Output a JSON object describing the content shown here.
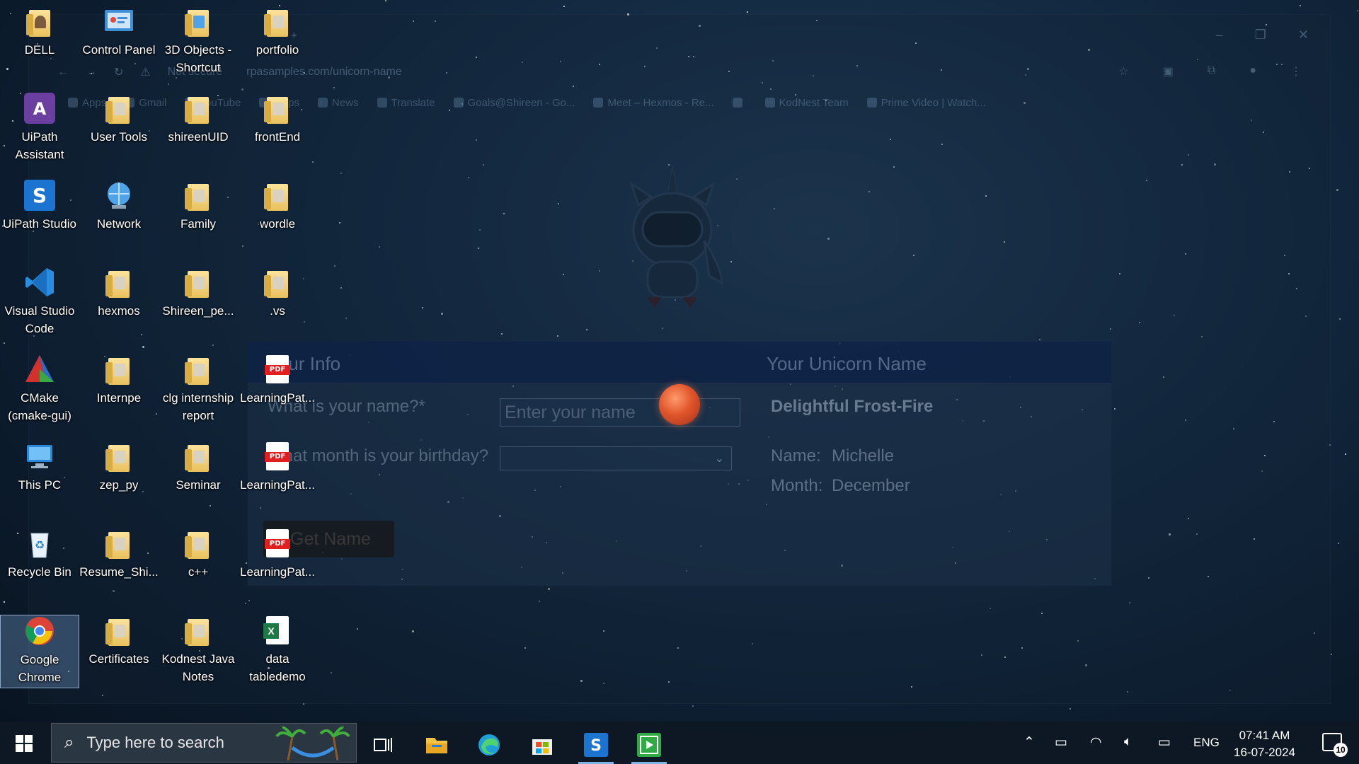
{
  "browser": {
    "tab_title": "",
    "url": "rpasamples.com/unicorn-name",
    "security_label": "Not secure",
    "bookmarks": [
      "Apps",
      "Gmail",
      "YouTube",
      "Maps",
      "News",
      "Translate",
      "Goals@Shireen - Go...",
      "Meet – Hexmos - Re...",
      "",
      "KodNest Team",
      "Prime Video | Watch..."
    ]
  },
  "form": {
    "section_info": "Your Info",
    "section_name": "Your Unicorn Name",
    "q_name": "What is your name?*",
    "name_placeholder": "Enter your name",
    "q_month": "What month is your birthday?",
    "month_value": "",
    "button": "Get Name",
    "result_title": "Delightful Frost-Fire",
    "result_name_label": "Name:",
    "result_name_value": "Michelle",
    "result_month_label": "Month:",
    "result_month_value": "December"
  },
  "desktop_icons": [
    {
      "label": "DELL"
    },
    {
      "label": "Control Panel"
    },
    {
      "label": "3D Objects - Shortcut"
    },
    {
      "label": "portfolio"
    },
    {
      "label": "UiPath Assistant"
    },
    {
      "label": "User Tools"
    },
    {
      "label": "shireenUID"
    },
    {
      "label": "frontEnd"
    },
    {
      "label": "UiPath Studio"
    },
    {
      "label": "Network"
    },
    {
      "label": "Family"
    },
    {
      "label": "wordle"
    },
    {
      "label": "Visual Studio Code"
    },
    {
      "label": "hexmos"
    },
    {
      "label": "Shireen_pe..."
    },
    {
      "label": ".vs"
    },
    {
      "label": "CMake (cmake-gui)"
    },
    {
      "label": "Internpe"
    },
    {
      "label": "clg internship report"
    },
    {
      "label": "LearningPat..."
    },
    {
      "label": "This PC"
    },
    {
      "label": "zep_py"
    },
    {
      "label": "Seminar"
    },
    {
      "label": "LearningPat..."
    },
    {
      "label": "Recycle Bin"
    },
    {
      "label": "Resume_Shi..."
    },
    {
      "label": "c++"
    },
    {
      "label": "LearningPat..."
    },
    {
      "label": "Google Chrome"
    },
    {
      "label": "Certificates"
    },
    {
      "label": "Kodnest Java Notes"
    },
    {
      "label": "data tabledemo"
    }
  ],
  "taskbar": {
    "search_placeholder": "Type here to search",
    "language": "ENG",
    "time": "07:41 AM",
    "date": "16-07-2024",
    "notification_count": "10"
  }
}
